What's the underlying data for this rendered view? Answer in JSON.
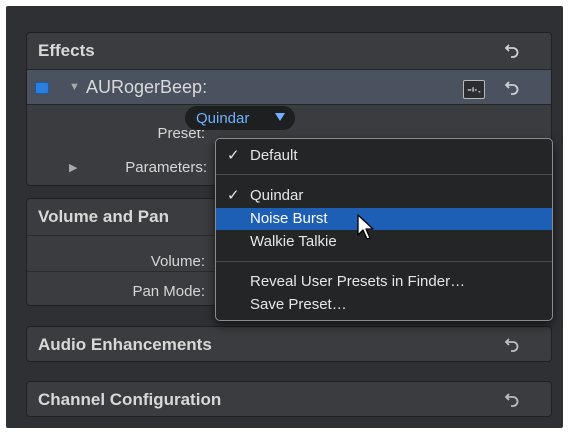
{
  "effects": {
    "title": "Effects",
    "effect_name": "AURogerBeep:",
    "preset_label": "Preset:",
    "preset_value": "Quindar",
    "parameters_label": "Parameters:"
  },
  "volume_pan": {
    "title": "Volume and Pan",
    "volume_label": "Volume:",
    "pan_mode_label": "Pan Mode:"
  },
  "audio_enhancements": {
    "title": "Audio Enhancements"
  },
  "channel_configuration": {
    "title": "Channel Configuration"
  },
  "preset_menu": {
    "items": [
      {
        "label": "Default",
        "checked": true
      },
      {
        "label": "Quindar",
        "checked": true
      },
      {
        "label": "Noise Burst",
        "highlighted": true
      },
      {
        "label": "Walkie Talkie"
      },
      {
        "label": "Reveal User Presets in Finder…"
      },
      {
        "label": "Save Preset…"
      }
    ],
    "check_glyph": "✓"
  },
  "icons": {
    "reset": "reset-arrow-icon",
    "settings": "effect-settings-icon",
    "checkbox": "enable-checkbox",
    "cursor": "pointer-cursor"
  },
  "colors": {
    "accent": "#2a7fe0",
    "highlight": "#1c5fb4",
    "preset_text": "#6fb0ff"
  }
}
